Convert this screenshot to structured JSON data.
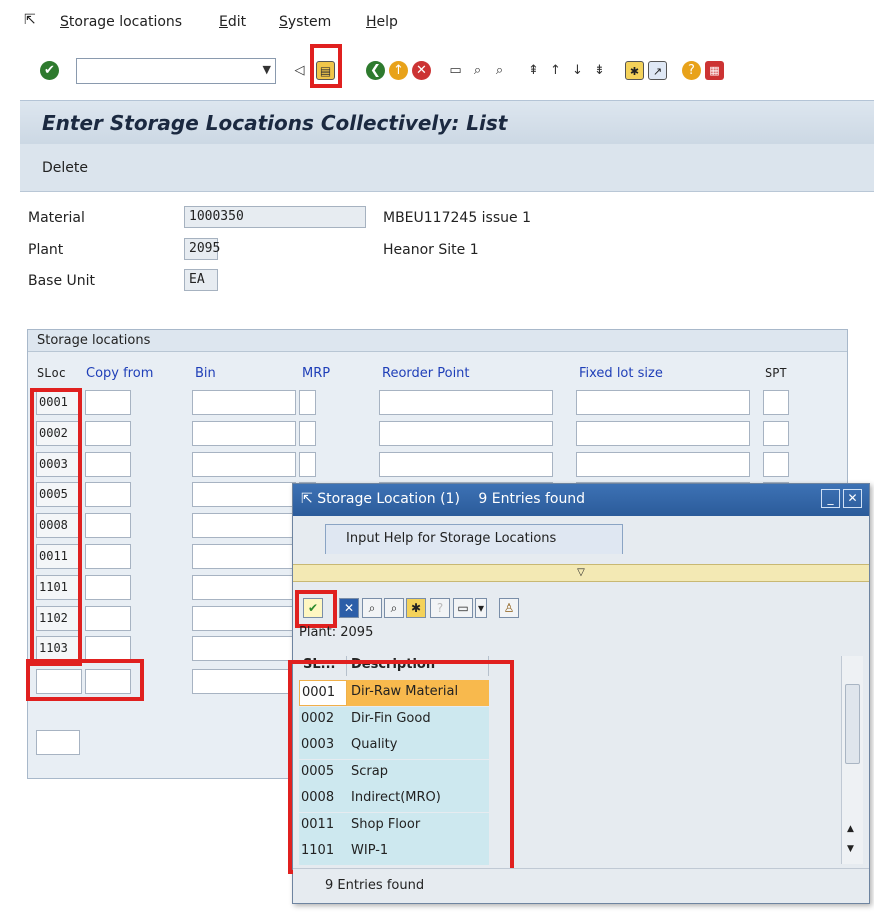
{
  "menu": {
    "items": [
      "Storage locations",
      "Edit",
      "System",
      "Help"
    ]
  },
  "toolbar": {
    "command_value": ""
  },
  "title": "Enter Storage Locations Collectively: List",
  "app_toolbar": {
    "delete_label": "Delete"
  },
  "header": {
    "material_label": "Material",
    "material_value": "1000350",
    "material_desc": "MBEU117245 issue 1",
    "plant_label": "Plant",
    "plant_value": "2095",
    "plant_desc": "Heanor Site 1",
    "base_unit_label": "Base Unit",
    "base_unit_value": "EA"
  },
  "storage_group": {
    "title": "Storage locations",
    "columns": {
      "sloc": "SLoc",
      "copy_from": "Copy from",
      "bin": "Bin",
      "mrp": "MRP",
      "reorder": "Reorder Point",
      "fixed_lot": "Fixed lot size",
      "spt": "SPT"
    },
    "slocs": [
      "0001",
      "0002",
      "0003",
      "0005",
      "0008",
      "0011",
      "1101",
      "1102",
      "1103"
    ]
  },
  "popup": {
    "title": "Storage Location (1)",
    "entries_title": "9 Entries found",
    "tab": "Input Help for Storage Locations",
    "plant_line": "Plant: 2095",
    "col_key": "SL...",
    "col_desc": "Description",
    "rows": [
      {
        "key": "0001",
        "desc": "Dir-Raw Material"
      },
      {
        "key": "0002",
        "desc": "Dir-Fin Good"
      },
      {
        "key": "0003",
        "desc": "Quality"
      },
      {
        "key": "0005",
        "desc": "Scrap"
      },
      {
        "key": "0008",
        "desc": "Indirect(MRO)"
      },
      {
        "key": "0011",
        "desc": "Shop Floor"
      },
      {
        "key": "1101",
        "desc": "WIP-1"
      }
    ],
    "status": "9 Entries found"
  },
  "colors": {
    "highlight": "#e0201f",
    "selected_row": "#f8b94d",
    "title_bar": "#2b5b9a"
  }
}
